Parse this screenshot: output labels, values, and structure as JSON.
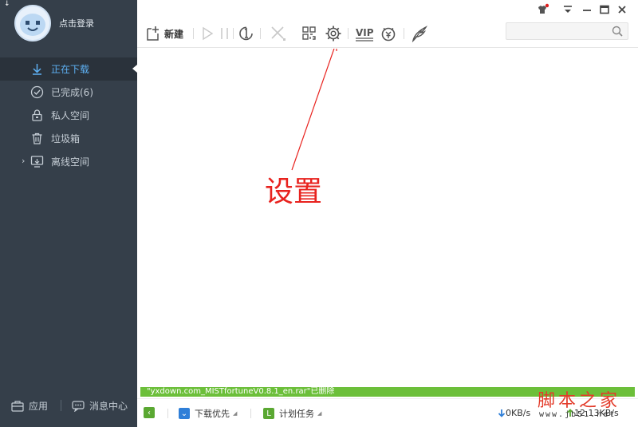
{
  "sidebar": {
    "login_label": "点击登录",
    "nav": [
      {
        "label": "正在下载"
      },
      {
        "label": "已完成(6)"
      },
      {
        "label": "私人空间"
      },
      {
        "label": "垃圾箱"
      },
      {
        "label": "离线空间"
      }
    ],
    "bottom": {
      "apps_label": "应用",
      "messages_label": "消息中心"
    }
  },
  "toolbar": {
    "new_label": "新建",
    "vip_label": "VIP",
    "search_placeholder": ""
  },
  "annotation": {
    "text": "设置"
  },
  "notice": {
    "text": "\"yxdown.com_MISTfortuneV0.8.1_en.rar\"已删除"
  },
  "statusbar": {
    "priority_label": "下载优先",
    "schedule_label": "计划任务",
    "download_speed": "0KB/s",
    "upload_speed": "12.13KB/s"
  },
  "watermark": {
    "title": "脚本之家",
    "url": "www.jb51.net"
  },
  "colors": {
    "sidebar_bg": "#353f4a",
    "active_item": "#5eb1f4",
    "annotation_red": "#e8221e",
    "notice_green": "#6cbf3a"
  }
}
